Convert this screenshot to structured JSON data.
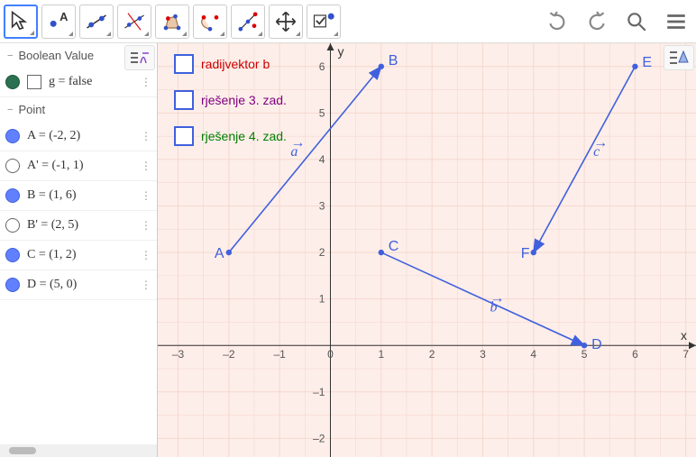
{
  "toolbar_icons": [
    "move-arrow",
    "point",
    "line",
    "perpendicular-line",
    "polygon",
    "circle",
    "angle",
    "reflect",
    "move-graphics",
    "checkbox-tool"
  ],
  "toolbar_right_icons": [
    "undo",
    "redo",
    "search",
    "menu"
  ],
  "algebra_badge_icon": "algebra-view-icon",
  "graphics_badge_icon": "graphics-style-icon",
  "sections": {
    "boolean": {
      "title": "Boolean Value",
      "rows": [
        {
          "bullet": "filled-green",
          "label": "g = false"
        }
      ]
    },
    "point": {
      "title": "Point",
      "rows": [
        {
          "bullet": "filled-blue",
          "label": "A = (-2, 2)"
        },
        {
          "bullet": "empty",
          "label": "A' = (-1, 1)"
        },
        {
          "bullet": "filled-blue",
          "label": "B = (1, 6)"
        },
        {
          "bullet": "empty",
          "label": "B' = (2, 5)"
        },
        {
          "bullet": "filled-blue",
          "label": "C = (1, 2)"
        },
        {
          "bullet": "filled-blue",
          "label": "D = (5, 0)"
        }
      ]
    }
  },
  "checkboxes": [
    {
      "label": "radijvektor b",
      "color": "#cc0000"
    },
    {
      "label": "rješenje 3. zad.",
      "color": "#800080"
    },
    {
      "label": "rješenje 4. zad.",
      "color": "#008000"
    }
  ],
  "chart_data": {
    "type": "vector-plot",
    "x_axis": {
      "label": "x",
      "min": -3,
      "max": 7,
      "ticks": [
        -3,
        -2,
        -1,
        0,
        1,
        2,
        3,
        4,
        5,
        6,
        7
      ]
    },
    "y_axis": {
      "label": "y",
      "min": -2,
      "max": 6,
      "ticks": [
        -2,
        -1,
        1,
        2,
        3,
        4,
        5,
        6
      ]
    },
    "grid": true,
    "points": [
      {
        "name": "A",
        "x": -2,
        "y": 2
      },
      {
        "name": "B",
        "x": 1,
        "y": 6
      },
      {
        "name": "C",
        "x": 1,
        "y": 2
      },
      {
        "name": "D",
        "x": 5,
        "y": 0
      },
      {
        "name": "E",
        "x": 6,
        "y": 6
      },
      {
        "name": "F",
        "x": 4,
        "y": 2
      }
    ],
    "vectors": [
      {
        "name": "a",
        "from": "A",
        "to": "B"
      },
      {
        "name": "b",
        "from": "C",
        "to": "D"
      },
      {
        "name": "c",
        "from": "E",
        "to": "F"
      }
    ]
  }
}
